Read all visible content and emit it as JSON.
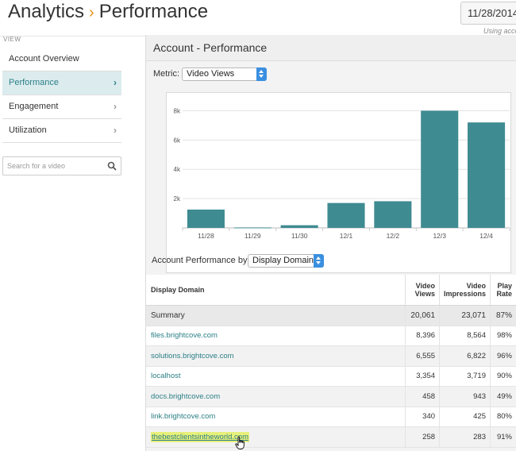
{
  "header": {
    "title_part1": "Analytics",
    "title_part2": "Performance",
    "date": "11/28/2014",
    "using_note": "Using acco"
  },
  "sidebar": {
    "view_label": "VIEW",
    "items": [
      {
        "label": "Account Overview",
        "chevron": false
      },
      {
        "label": "Performance",
        "chevron": true,
        "active": true
      },
      {
        "label": "Engagement",
        "chevron": true
      },
      {
        "label": "Utilization",
        "chevron": true
      }
    ],
    "search_placeholder": "Search for a video"
  },
  "panel": {
    "title": "Account - Performance",
    "metric_label": "Metric:",
    "metric_value": "Video Views",
    "by_label": "Account Performance by",
    "by_value": "Display Domain"
  },
  "chart_data": {
    "type": "bar",
    "categories": [
      "11/28",
      "11/29",
      "11/30",
      "12/1",
      "12/2",
      "12/3",
      "12/4"
    ],
    "values": [
      1250,
      30,
      180,
      1700,
      1820,
      8000,
      7200
    ],
    "ylim": [
      0,
      9000
    ],
    "yticks": [
      2000,
      4000,
      6000,
      8000
    ],
    "ytick_labels": [
      "2k",
      "4k",
      "6k",
      "8k"
    ],
    "grid": true,
    "bar_color": "#3f8b92"
  },
  "table": {
    "headers": [
      "Display Domain",
      "Video Views",
      "Video Impressions",
      "Play Rate"
    ],
    "header_lines": [
      [
        "Display Domain"
      ],
      [
        "Video",
        "Views"
      ],
      [
        "Video",
        "Impressions"
      ],
      [
        "Play",
        "Rate"
      ]
    ],
    "summary": [
      "Summary",
      "20,061",
      "23,071",
      "87%"
    ],
    "rows": [
      [
        "files.brightcove.com",
        "8,396",
        "8,564",
        "98%"
      ],
      [
        "solutions.brightcove.com",
        "6,555",
        "6,822",
        "96%"
      ],
      [
        "localhost",
        "3,354",
        "3,719",
        "90%"
      ],
      [
        "docs.brightcove.com",
        "458",
        "943",
        "49%"
      ],
      [
        "link.brightcove.com",
        "340",
        "425",
        "80%"
      ],
      [
        "thebestclientsintheworld.com",
        "258",
        "283",
        "91%"
      ]
    ]
  }
}
